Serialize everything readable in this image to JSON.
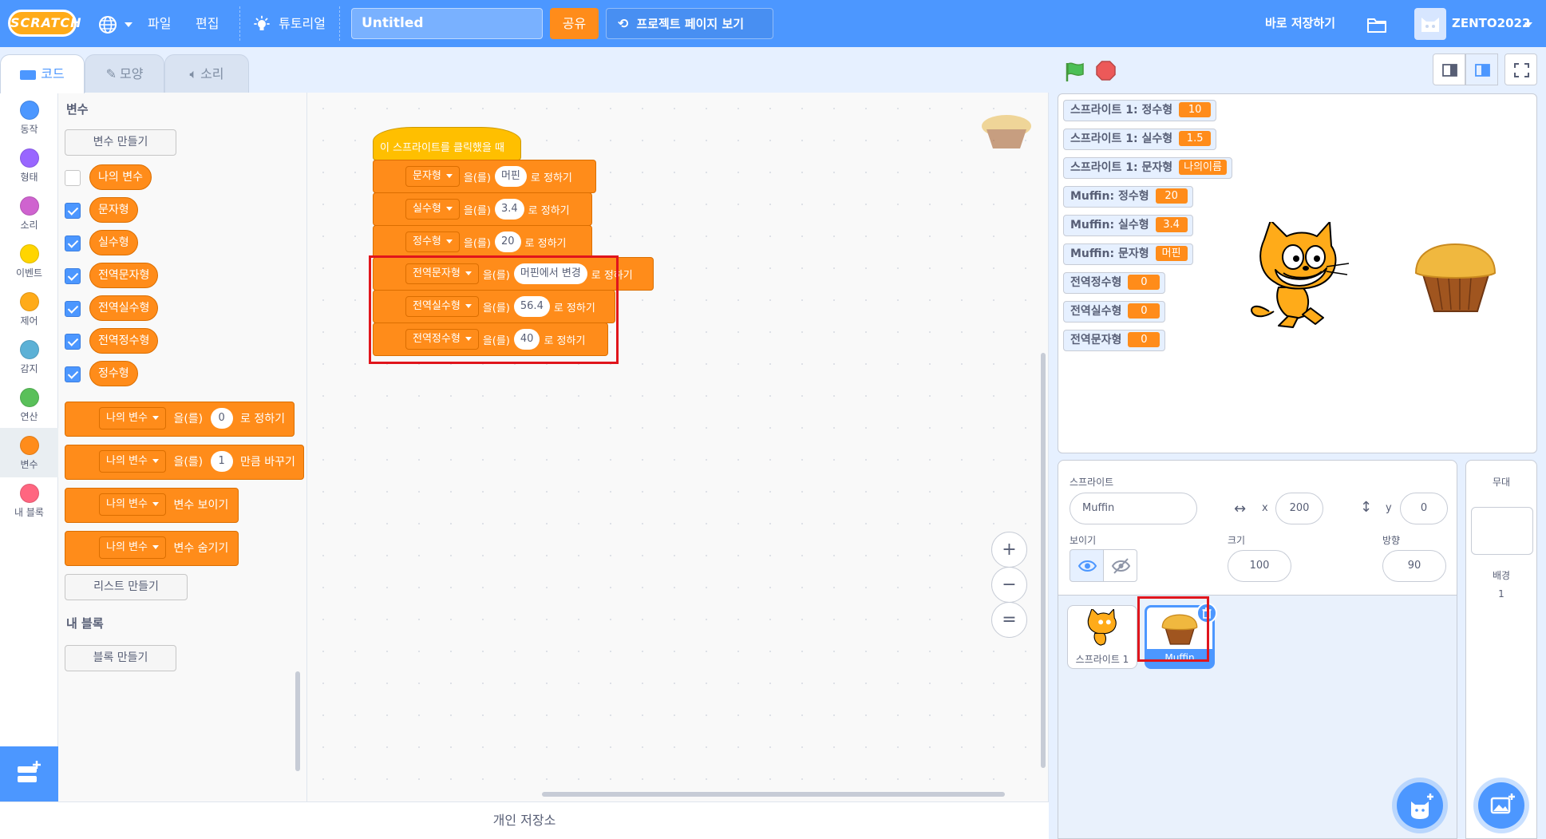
{
  "menubar": {
    "logo": "SCRATCH",
    "file": "파일",
    "edit": "편집",
    "tutorials": "튜토리얼",
    "project_title": "Untitled",
    "share": "공유",
    "see_project_page": "프로젝트 페이지 보기",
    "save_now": "바로 저장하기",
    "username": "ZENTO2022"
  },
  "tabs": {
    "code": "코드",
    "costumes": "모양",
    "sounds": "소리"
  },
  "categories": [
    {
      "label": "동작",
      "color": "#4c97ff"
    },
    {
      "label": "형태",
      "color": "#9966ff"
    },
    {
      "label": "소리",
      "color": "#cf63cf"
    },
    {
      "label": "이벤트",
      "color": "#ffd500"
    },
    {
      "label": "제어",
      "color": "#ffab19"
    },
    {
      "label": "감지",
      "color": "#5cb1d6"
    },
    {
      "label": "연산",
      "color": "#59c059"
    },
    {
      "label": "변수",
      "color": "#ff8c1a"
    },
    {
      "label": "내 블록",
      "color": "#ff6680"
    }
  ],
  "palette": {
    "heading_variables": "변수",
    "make_variable": "변수 만들기",
    "variables": [
      {
        "name": "나의 변수",
        "checked": false
      },
      {
        "name": "문자형",
        "checked": true
      },
      {
        "name": "실수형",
        "checked": true
      },
      {
        "name": "전역문자형",
        "checked": true
      },
      {
        "name": "전역실수형",
        "checked": true
      },
      {
        "name": "전역정수형",
        "checked": true
      },
      {
        "name": "정수형",
        "checked": true
      }
    ],
    "blocks": [
      {
        "var": "나의 변수",
        "text1": "을(를)",
        "value": "0",
        "text2": "로 정하기"
      },
      {
        "var": "나의 변수",
        "text1": "을(를)",
        "value": "1",
        "text2": "만큼 바꾸기"
      },
      {
        "var": "나의 변수",
        "text1": "변수 보이기"
      },
      {
        "var": "나의 변수",
        "text1": "변수 숨기기"
      }
    ],
    "make_list": "리스트 만들기",
    "heading_my_blocks": "내 블록",
    "make_block": "블록 만들기"
  },
  "script": {
    "hat": "이 스프라이트를 클릭했을 때",
    "set_blocks": [
      {
        "var": "문자형",
        "text1": "을(를)",
        "value": "머핀",
        "text2": "로 정하기"
      },
      {
        "var": "실수형",
        "text1": "을(를)",
        "value": "3.4",
        "text2": "로 정하기"
      },
      {
        "var": "정수형",
        "text1": "을(를)",
        "value": "20",
        "text2": "로 정하기"
      },
      {
        "var": "전역문자형",
        "text1": "을(를)",
        "value": "머핀에서 변경",
        "text2": "로 정하기"
      },
      {
        "var": "전역실수형",
        "text1": "을(를)",
        "value": "56.4",
        "text2": "로 정하기"
      },
      {
        "var": "전역정수형",
        "text1": "을(를)",
        "value": "40",
        "text2": "로 정하기"
      }
    ]
  },
  "zoom": {
    "in": "+",
    "out": "−",
    "reset": "="
  },
  "backpack": "개인 저장소",
  "monitors": [
    {
      "label": "스프라이트 1: 정수형",
      "value": "10"
    },
    {
      "label": "스프라이트 1: 실수형",
      "value": "1.5"
    },
    {
      "label": "스프라이트 1: 문자형",
      "value": "나의이름"
    },
    {
      "label": "Muffin: 정수형",
      "value": "20"
    },
    {
      "label": "Muffin: 실수형",
      "value": "3.4"
    },
    {
      "label": "Muffin: 문자형",
      "value": "머핀"
    },
    {
      "label": "전역정수형",
      "value": "0"
    },
    {
      "label": "전역실수형",
      "value": "0"
    },
    {
      "label": "전역문자형",
      "value": "0"
    }
  ],
  "sprite_info": {
    "sprite_label": "스프라이트",
    "sprite_name": "Muffin",
    "x_label": "x",
    "x": "200",
    "y_label": "y",
    "y": "0",
    "show_label": "보이기",
    "size_label": "크기",
    "size": "100",
    "direction_label": "방향",
    "direction": "90"
  },
  "sprites": [
    {
      "name": "스프라이트 1",
      "selected": false
    },
    {
      "name": "Muffin",
      "selected": true
    }
  ],
  "stage_pane": {
    "title": "무대",
    "backdrops_label": "배경",
    "backdrops_count": "1"
  },
  "colors": {
    "accent": "#4c97ff",
    "variables": "#ff8c1a",
    "events": "#ffbf00",
    "highlight": "#e0151c"
  }
}
